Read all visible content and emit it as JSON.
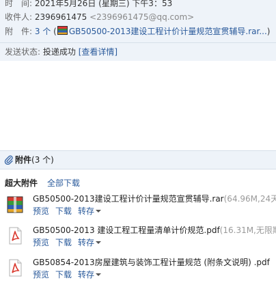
{
  "header": {
    "time_label": "时　间:",
    "time_value": "2021年5月26日 (星期三) 下午3：53",
    "recipient_label": "收件人:",
    "recipient_name": "2396961475",
    "recipient_addr": "<2396961475@qq.com>",
    "attach_label": "附　件:",
    "attach_count": "3 个",
    "attach_preview_open": "(",
    "attach_preview_name": "GB50500-2013建设工程计价计量规范宣贯辅导.rar...",
    "attach_preview_close": ")",
    "status_label": "发送状态:",
    "status_value": "投递成功",
    "status_detail": "[查看详情]"
  },
  "attachments_section": {
    "title": "附件",
    "count": "(3 个)",
    "big_label": "超大附件",
    "download_all": "全部下载"
  },
  "files": [
    {
      "icon": "rar-archive-icon",
      "name": "GB50500-2013建设工程计价计量规范宣贯辅导.rar",
      "meta": "(64.96M,24天",
      "actions": [
        "预览",
        "下载",
        "转存"
      ]
    },
    {
      "icon": "pdf-icon",
      "name": "GB50500-2013 建设工程工程量清单计价规范.pdf",
      "meta": "(16.31M,无限期",
      "actions": [
        "预览",
        "下载",
        "转存"
      ]
    },
    {
      "icon": "pdf-icon",
      "name": "GB50854-2013房屋建筑与装饰工程计量规范 (附条文说明) .pdf",
      "meta": "",
      "actions": [
        "预览",
        "下载",
        "转存"
      ]
    }
  ],
  "colors": {
    "link": "#2a5a9b",
    "header_bg": "#eef3f9",
    "pdf_red": "#d9362b"
  }
}
